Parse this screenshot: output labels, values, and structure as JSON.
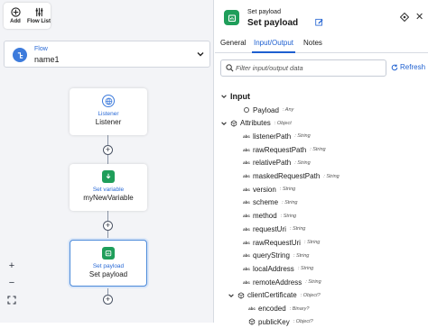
{
  "toolbar": {
    "add_label": "Add",
    "flow_list_label": "Flow List"
  },
  "flow_selector": {
    "label": "Flow",
    "name": "name1"
  },
  "nodes": [
    {
      "type": "Listener",
      "name": "Listener"
    },
    {
      "type": "Set variable",
      "name": "myNewVariable"
    },
    {
      "type": "Set payload",
      "name": "Set payload"
    }
  ],
  "zoom": {
    "in": "+",
    "out": "−"
  },
  "panel": {
    "subtitle": "Set payload",
    "title": "Set payload",
    "tabs": [
      "General",
      "Input/Output",
      "Notes"
    ],
    "active_tab": "Input/Output",
    "search_placeholder": "Filter input/output data",
    "refresh_label": "Refresh",
    "tree_root": "Input",
    "tree": [
      {
        "name": "Payload",
        "type": ": Any"
      },
      {
        "name": "Attributes",
        "type": ": Object"
      },
      {
        "name": "listenerPath",
        "type": ": String"
      },
      {
        "name": "rawRequestPath",
        "type": ": String"
      },
      {
        "name": "relativePath",
        "type": ": String"
      },
      {
        "name": "maskedRequestPath",
        "type": ": String"
      },
      {
        "name": "version",
        "type": ": String"
      },
      {
        "name": "scheme",
        "type": ": String"
      },
      {
        "name": "method",
        "type": ": String"
      },
      {
        "name": "requestUri",
        "type": ": String"
      },
      {
        "name": "rawRequestUri",
        "type": ": String"
      },
      {
        "name": "queryString",
        "type": ": String"
      },
      {
        "name": "localAddress",
        "type": ": String"
      },
      {
        "name": "remoteAddress",
        "type": ": String"
      },
      {
        "name": "clientCertificate",
        "type": ": Object?"
      },
      {
        "name": "encoded",
        "type": ": Binary?"
      },
      {
        "name": "publicKey",
        "type": ": Object?"
      }
    ],
    "string_icon_text": "abc"
  }
}
